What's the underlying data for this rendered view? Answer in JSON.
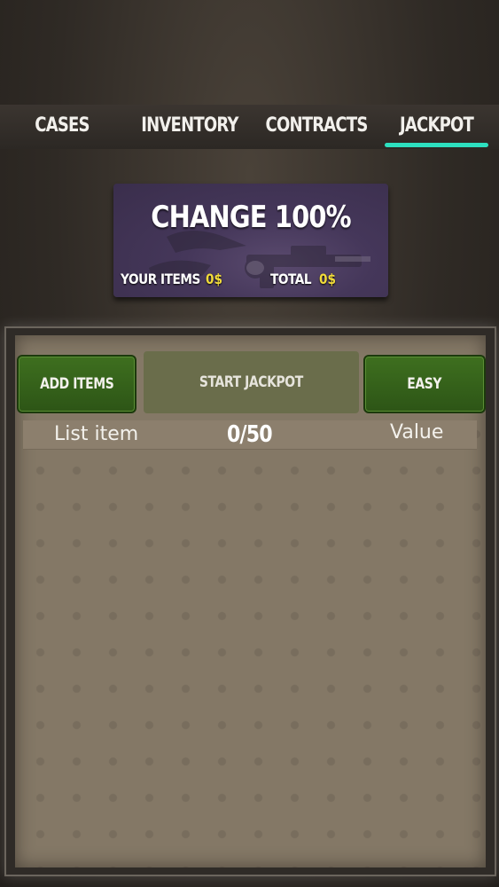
{
  "tabs": [
    {
      "label": "CASES",
      "active": false
    },
    {
      "label": "INVENTORY",
      "active": false
    },
    {
      "label": "CONTRACTS",
      "active": false
    },
    {
      "label": "JACKPOT",
      "active": true
    }
  ],
  "accent_color": "#2de0c0",
  "banner": {
    "title": "CHANGE 100%",
    "your_items_label": "YOUR ITEMS",
    "your_items_value": "0$",
    "total_label": "TOTAL",
    "total_value": "0$"
  },
  "controls": {
    "add_items": "ADD ITEMS",
    "start_jackpot": "START JACKPOT",
    "difficulty": "EASY"
  },
  "list": {
    "left_header": "List item",
    "count": "0/50",
    "right_header": "Value"
  },
  "colors": {
    "button_green": "#3e6f1f",
    "value_yellow": "#f2dc3a"
  }
}
